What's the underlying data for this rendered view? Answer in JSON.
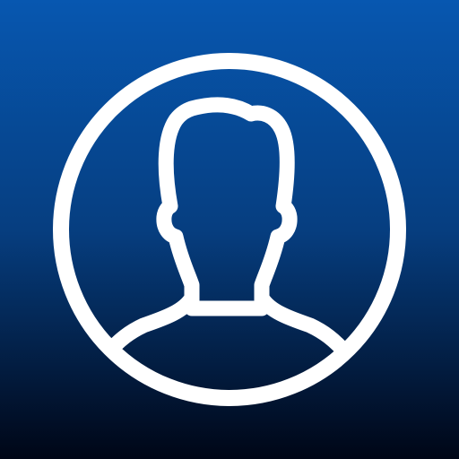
{
  "icon": {
    "name": "user-profile-icon",
    "colors": {
      "gradient_top": "#0757B0",
      "gradient_mid": "#063E80",
      "gradient_bottom": "#000616",
      "stroke": "#FFFFFF"
    }
  }
}
